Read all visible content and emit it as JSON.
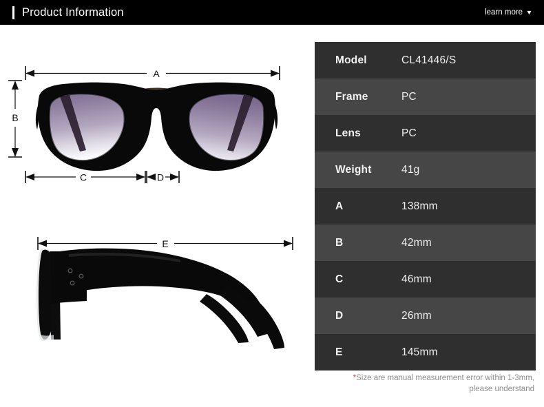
{
  "header": {
    "title": "Product Information",
    "learn_more_label": "learn more",
    "caret_icon": "chevron-down-icon",
    "background_color": "#000000",
    "accent_color": "#ffffff"
  },
  "diagram": {
    "front_view": {
      "name": "sunglasses-front-view",
      "dimension_labels": {
        "a": "A",
        "b": "B",
        "c": "C",
        "d": "D"
      }
    },
    "side_view": {
      "name": "sunglasses-side-view",
      "dimension_labels": {
        "e": "E"
      }
    },
    "frame_color": "#0a0a0a",
    "lens_gradient_top": "#8d7d9d",
    "lens_gradient_bottom": "#fbfafc"
  },
  "spec_table": {
    "rows": [
      {
        "key": "Model",
        "value": "CL41446/S"
      },
      {
        "key": "Frame",
        "value": "PC"
      },
      {
        "key": "Lens",
        "value": "PC"
      },
      {
        "key": "Weight",
        "value": "41g"
      },
      {
        "key": "A",
        "value": "138mm"
      },
      {
        "key": "B",
        "value": "42mm"
      },
      {
        "key": "C",
        "value": "46mm"
      },
      {
        "key": "D",
        "value": "26mm"
      },
      {
        "key": "E",
        "value": "145mm"
      }
    ],
    "row_color_odd": "#2f2f2f",
    "row_color_even": "#464646",
    "note_asterisk": "*",
    "note_line_1": "Size are manual measurement error within 1-3mm,",
    "note_line_2": "please understand",
    "note_color": "#8e8e8e",
    "asterisk_color": "#e03a3a"
  }
}
